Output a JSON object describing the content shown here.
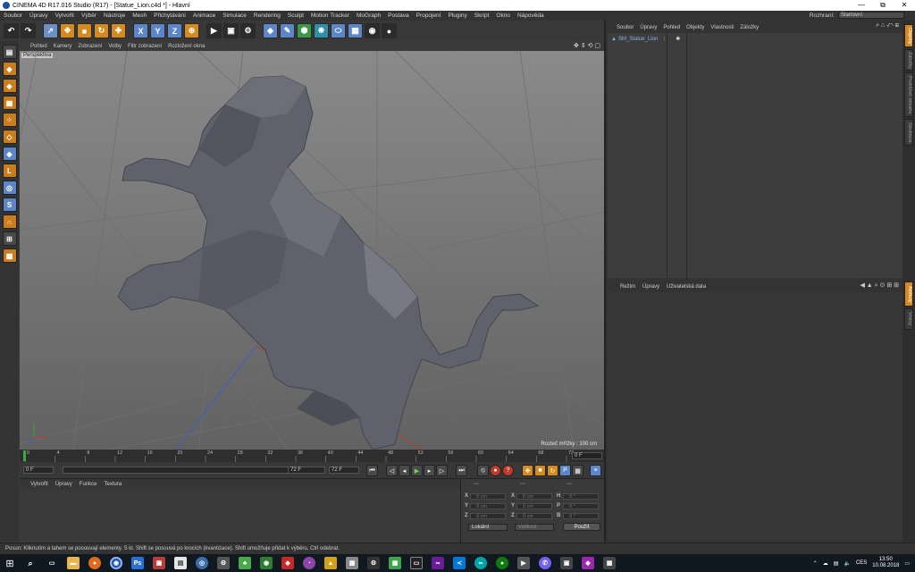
{
  "window": {
    "title": "CINEMA 4D R17.016 Studio (R17) - [Statue_Lion.c4d *] - Hlavní",
    "minimize": "—",
    "maximize": "⧉",
    "close": "✕"
  },
  "menu": [
    "Soubor",
    "Úpravy",
    "Vytvořit",
    "Výběr",
    "Nástroje",
    "Mesh",
    "Přichytávání",
    "Animace",
    "Simulace",
    "Rendering",
    "Sculpt",
    "Motion Tracker",
    "MoGraph",
    "Postava",
    "Propojení",
    "Pluginy",
    "Skript",
    "Okno",
    "Nápověda"
  ],
  "layout": {
    "label": "Rozhraní:",
    "value": "Startovní"
  },
  "toolbar": {
    "axes": [
      "X",
      "Y",
      "Z"
    ]
  },
  "viewport": {
    "menu": [
      "Pohled",
      "Kamery",
      "Zobrazení",
      "Volby",
      "Filtr zobrazení",
      "Rozložení okna"
    ],
    "camera_label": "Perspektiva",
    "grid_scale": "Rozteč mřížky : 100 cm",
    "nav_icons": "✥ ⇕ ⟲ ▢"
  },
  "timeline": {
    "ticks": [
      "0",
      "4",
      "8",
      "12",
      "16",
      "20",
      "24",
      "28",
      "32",
      "36",
      "40",
      "44",
      "48",
      "52",
      "56",
      "60",
      "64",
      "68",
      "72"
    ],
    "current_frame": "0 F"
  },
  "transport": {
    "start_field": "0 F",
    "end_field": "72 F",
    "max_field": "72 F"
  },
  "materials": {
    "menu": [
      "Vytvořit",
      "Úpravy",
      "Funkce",
      "Textura"
    ]
  },
  "coordinates": {
    "headers": [
      "---",
      "---",
      "---"
    ],
    "rows": [
      {
        "a_label": "X",
        "a_val": "0 cm",
        "b_label": "X",
        "b_val": "0 cm",
        "c_label": "H",
        "c_val": "0 °"
      },
      {
        "a_label": "Y",
        "a_val": "0 cm",
        "b_label": "Y",
        "b_val": "0 cm",
        "c_label": "P",
        "c_val": "0 °"
      },
      {
        "a_label": "Z",
        "a_val": "0 cm",
        "b_label": "Z",
        "b_val": "0 cm",
        "c_label": "B",
        "c_val": "0 °"
      }
    ],
    "mode": "Lokální",
    "size_mode": "Velikost",
    "apply": "Použít"
  },
  "object_manager": {
    "menu": [
      "Soubor",
      "Úpravy",
      "Pohled",
      "Objekty",
      "Vlastnosti",
      "Záložky"
    ],
    "object_name": "SM_Statue_Lion"
  },
  "attribute_manager": {
    "menu": [
      "Režim",
      "Úpravy",
      "Uživatelská data"
    ]
  },
  "side_tabs": [
    "Objekty",
    "Záložky",
    "Prohlížeč obsahu",
    "Struktura"
  ],
  "side_tabs_lower": [
    "Atributy",
    "Vrstvy"
  ],
  "status": "Posun: Kliknutím a tahem se posouvají elementy. S kl. Shift se posouvá po krocích (kvantizace). Shift umožňuje přidat k výběru, Ctrl odebrat.",
  "tray": {
    "lang": "CES",
    "time": "13:50",
    "date": "10.08.2018"
  },
  "colors": {
    "accent": "#d48a1e",
    "selection_blue": "#5c86c8",
    "record_red": "#c0392b",
    "x_axis": "#c0392b",
    "y_axis": "#3aa83a",
    "z_axis": "#3a5fc8"
  }
}
